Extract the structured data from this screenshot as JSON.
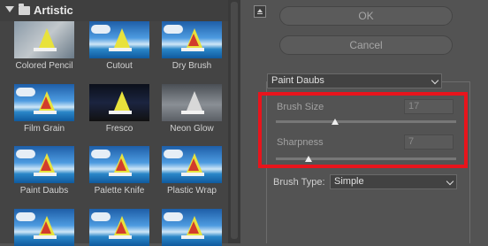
{
  "gallery": {
    "category": "Artistic",
    "thumbnails": [
      {
        "label": "Colored Pencil"
      },
      {
        "label": "Cutout"
      },
      {
        "label": "Dry Brush"
      },
      {
        "label": "Film Grain"
      },
      {
        "label": "Fresco"
      },
      {
        "label": "Neon Glow"
      },
      {
        "label": "Paint Daubs"
      },
      {
        "label": "Palette Knife"
      },
      {
        "label": "Plastic Wrap"
      }
    ]
  },
  "buttons": {
    "ok": "OK",
    "cancel": "Cancel"
  },
  "filter_select": {
    "value": "Paint Daubs"
  },
  "params": {
    "brush_size": {
      "label": "Brush Size",
      "value": "17"
    },
    "sharpness": {
      "label": "Sharpness",
      "value": "7"
    }
  },
  "brush_type": {
    "label": "Brush Type:",
    "value": "Simple"
  },
  "colors": {
    "highlight": "#e8141c",
    "panel": "#444444",
    "background": "#535353"
  }
}
